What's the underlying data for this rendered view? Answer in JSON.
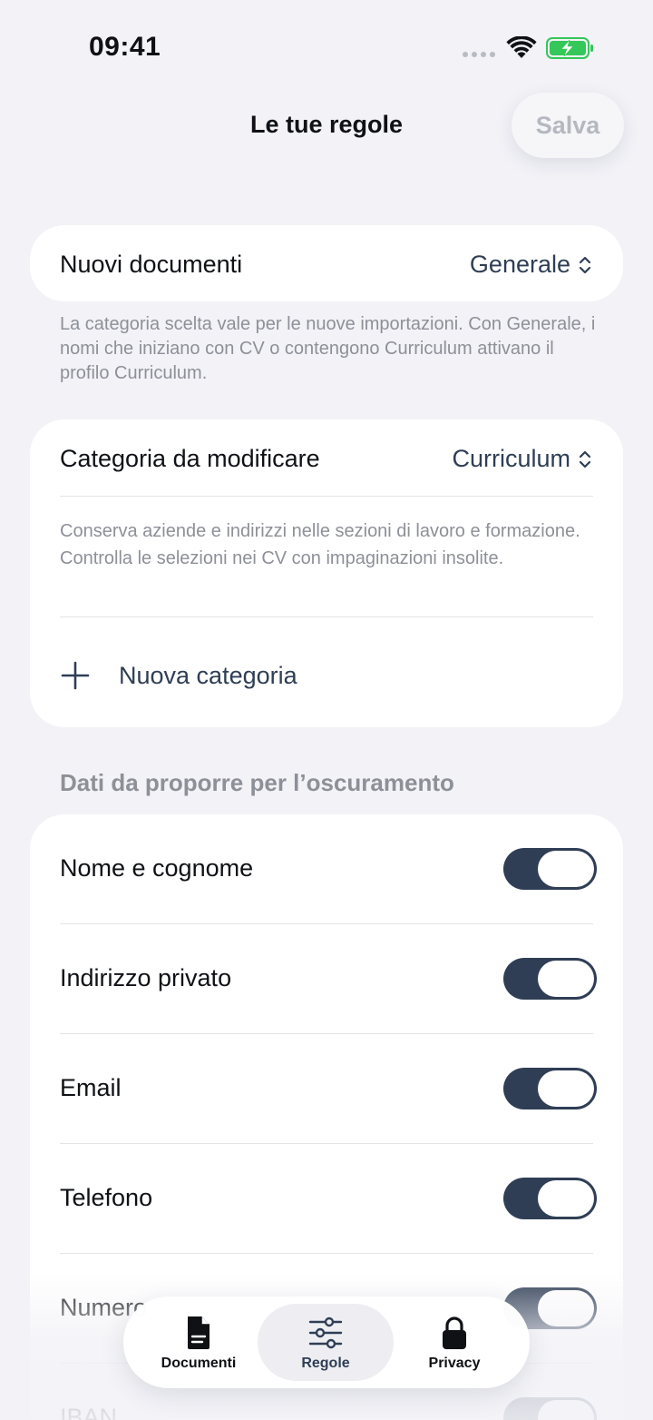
{
  "status_bar": {
    "time": "09:41"
  },
  "header": {
    "title": "Le tue regole",
    "save_label": "Salva"
  },
  "new_documents": {
    "label": "Nuovi documenti",
    "value": "Generale",
    "footnote": "La categoria scelta vale per le nuove importazioni. Con Generale, i nomi che iniziano con CV o contengono Curriculum attivano il profilo Curriculum."
  },
  "category_edit": {
    "label": "Categoria da modificare",
    "value": "Curriculum",
    "description": "Conserva aziende e indirizzi nelle sezioni di lavoro e formazione. Controlla le selezioni nei CV con impaginazioni insolite.",
    "add_label": "Nuova categoria"
  },
  "redaction": {
    "header": "Dati da proporre per l’oscuramento",
    "items": [
      {
        "label": "Nome e cognome",
        "enabled": true
      },
      {
        "label": "Indirizzo privato",
        "enabled": true
      },
      {
        "label": "Email",
        "enabled": true
      },
      {
        "label": "Telefono",
        "enabled": true
      },
      {
        "label": "Numero",
        "enabled": true
      },
      {
        "label": "IBAN",
        "enabled": true
      }
    ]
  },
  "tab_bar": {
    "tabs": [
      {
        "label": "Documenti",
        "icon": "document-icon",
        "active": false
      },
      {
        "label": "Regole",
        "icon": "sliders-icon",
        "active": true
      },
      {
        "label": "Privacy",
        "icon": "lock-icon",
        "active": false
      }
    ]
  },
  "colors": {
    "accent": "#2F3E55",
    "background": "#F2F2F7",
    "secondary_text": "#8E9098"
  }
}
